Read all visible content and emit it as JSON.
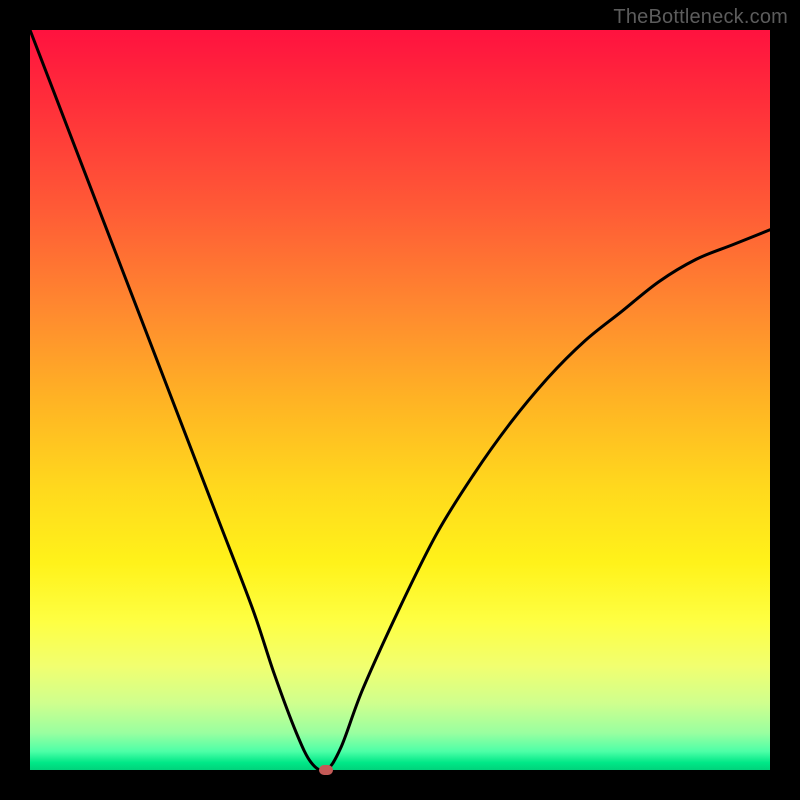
{
  "watermark": "TheBottleneck.com",
  "colors": {
    "frame": "#000000",
    "curve": "#000000",
    "marker": "#c45a57"
  },
  "chart_data": {
    "type": "line",
    "title": "",
    "xlabel": "",
    "ylabel": "",
    "xlim": [
      0,
      100
    ],
    "ylim": [
      0,
      100
    ],
    "grid": false,
    "legend": false,
    "tick_labels": {
      "x": [],
      "y": []
    },
    "series": [
      {
        "name": "bottleneck-curve",
        "x": [
          0,
          5,
          10,
          15,
          20,
          25,
          30,
          33,
          36,
          38,
          40,
          42,
          45,
          50,
          55,
          60,
          65,
          70,
          75,
          80,
          85,
          90,
          95,
          100
        ],
        "values": [
          100,
          87,
          74,
          61,
          48,
          35,
          22,
          13,
          5,
          1,
          0,
          3,
          11,
          22,
          32,
          40,
          47,
          53,
          58,
          62,
          66,
          69,
          71,
          73
        ]
      }
    ],
    "marker": {
      "x": 40,
      "y": 0
    },
    "note": "Values estimated from pixels; no axes or labels present in image."
  }
}
